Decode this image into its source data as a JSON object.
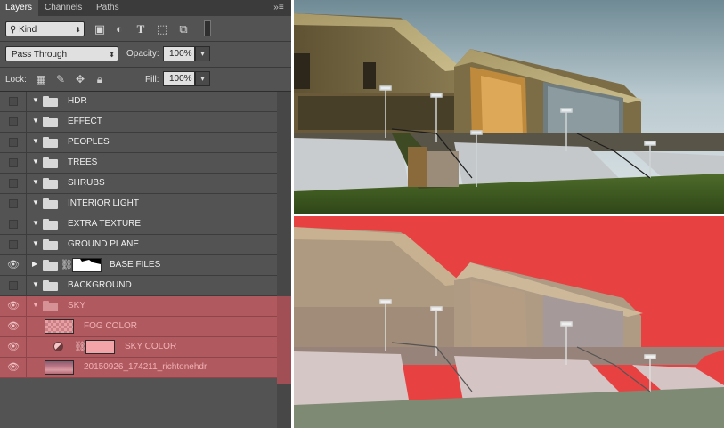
{
  "tabs": [
    {
      "label": "Layers",
      "active": true
    },
    {
      "label": "Channels",
      "active": false
    },
    {
      "label": "Paths",
      "active": false
    }
  ],
  "filter": {
    "kind_label": "Kind",
    "icons": [
      "image-filter-icon",
      "adjustment-filter-icon",
      "type-filter-icon",
      "shape-filter-icon",
      "smart-object-filter-icon",
      "filter-toggle-icon"
    ]
  },
  "blend": {
    "mode": "Pass Through",
    "opacity_label": "Opacity:",
    "opacity": "100%"
  },
  "lock": {
    "label": "Lock:",
    "fill_label": "Fill:",
    "fill": "100%"
  },
  "layers": [
    {
      "name": "HDR",
      "type": "group",
      "visible": false
    },
    {
      "name": "EFFECT",
      "type": "group",
      "visible": false
    },
    {
      "name": "PEOPLES",
      "type": "group",
      "visible": false
    },
    {
      "name": "TREES",
      "type": "group",
      "visible": false
    },
    {
      "name": "SHRUBS",
      "type": "group",
      "visible": false
    },
    {
      "name": "INTERIOR LIGHT",
      "type": "group",
      "visible": false
    },
    {
      "name": "EXTRA TEXTURE",
      "type": "group",
      "visible": false
    },
    {
      "name": "GROUND PLANE",
      "type": "group",
      "visible": false
    },
    {
      "name": "BASE FILES",
      "type": "group-masked",
      "visible": true
    },
    {
      "name": "BACKGROUND",
      "type": "group",
      "visible": false
    },
    {
      "name": "SKY",
      "type": "group",
      "visible": true
    },
    {
      "name": "FOG COLOR",
      "type": "layer",
      "visible": true
    },
    {
      "name": "SKY COLOR",
      "type": "adjustment",
      "visible": true
    },
    {
      "name": "20150926_174211_richtonehdr",
      "type": "image",
      "visible": true
    }
  ],
  "colors": {
    "panel": "#535353",
    "selection": "#b05a60",
    "sky_fill": "#e84142"
  }
}
